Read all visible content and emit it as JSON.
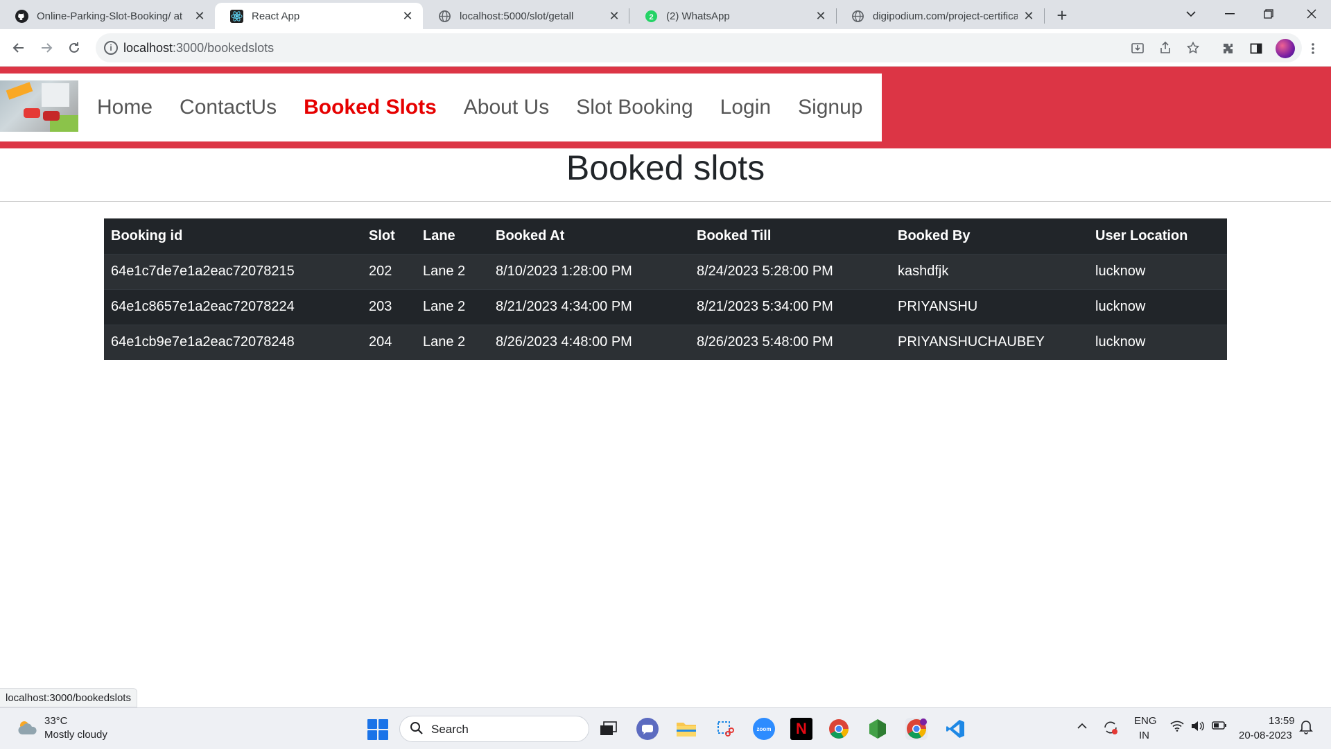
{
  "browser": {
    "tabs": [
      {
        "title": "Online-Parking-Slot-Booking/ at",
        "icon": "github-icon"
      },
      {
        "title": "React App",
        "icon": "react-icon"
      },
      {
        "title": "localhost:5000/slot/getall",
        "icon": "globe-icon"
      },
      {
        "title": "(2) WhatsApp",
        "icon": "whatsapp-icon",
        "badge": "2"
      },
      {
        "title": "digipodium.com/project-certifica",
        "icon": "globe-icon"
      }
    ],
    "url_host": "localhost",
    "url_path": ":3000/bookedslots",
    "status_url": "localhost:3000/bookedslots"
  },
  "nav": {
    "links": [
      "Home",
      "ContactUs",
      "Booked Slots",
      "About Us",
      "Slot Booking",
      "Login",
      "Signup"
    ],
    "active": "Booked Slots"
  },
  "page": {
    "heading": "Booked slots"
  },
  "table": {
    "headers": [
      "Booking id",
      "Slot",
      "Lane",
      "Booked At",
      "Booked Till",
      "Booked By",
      "User Location"
    ],
    "rows": [
      [
        "64e1c7de7e1a2eac72078215",
        "202",
        "Lane 2",
        "8/10/2023 1:28:00 PM",
        "8/24/2023 5:28:00 PM",
        "kashdfjk",
        "lucknow"
      ],
      [
        "64e1c8657e1a2eac72078224",
        "203",
        "Lane 2",
        "8/21/2023 4:34:00 PM",
        "8/21/2023 5:34:00 PM",
        "PRIYANSHU",
        "lucknow"
      ],
      [
        "64e1cb9e7e1a2eac72078248",
        "204",
        "Lane 2",
        "8/26/2023 4:48:00 PM",
        "8/26/2023 5:48:00 PM",
        "PRIYANSHUCHAUBEY",
        "lucknow"
      ]
    ]
  },
  "taskbar": {
    "weather_temp": "33°C",
    "weather_desc": "Mostly cloudy",
    "search_placeholder": "Search",
    "lang_line1": "ENG",
    "lang_line2": "IN",
    "time": "13:59",
    "date": "20-08-2023"
  },
  "colors": {
    "brand_red": "#dc3545",
    "active_link": "#e60000",
    "table_bg": "#212529"
  }
}
